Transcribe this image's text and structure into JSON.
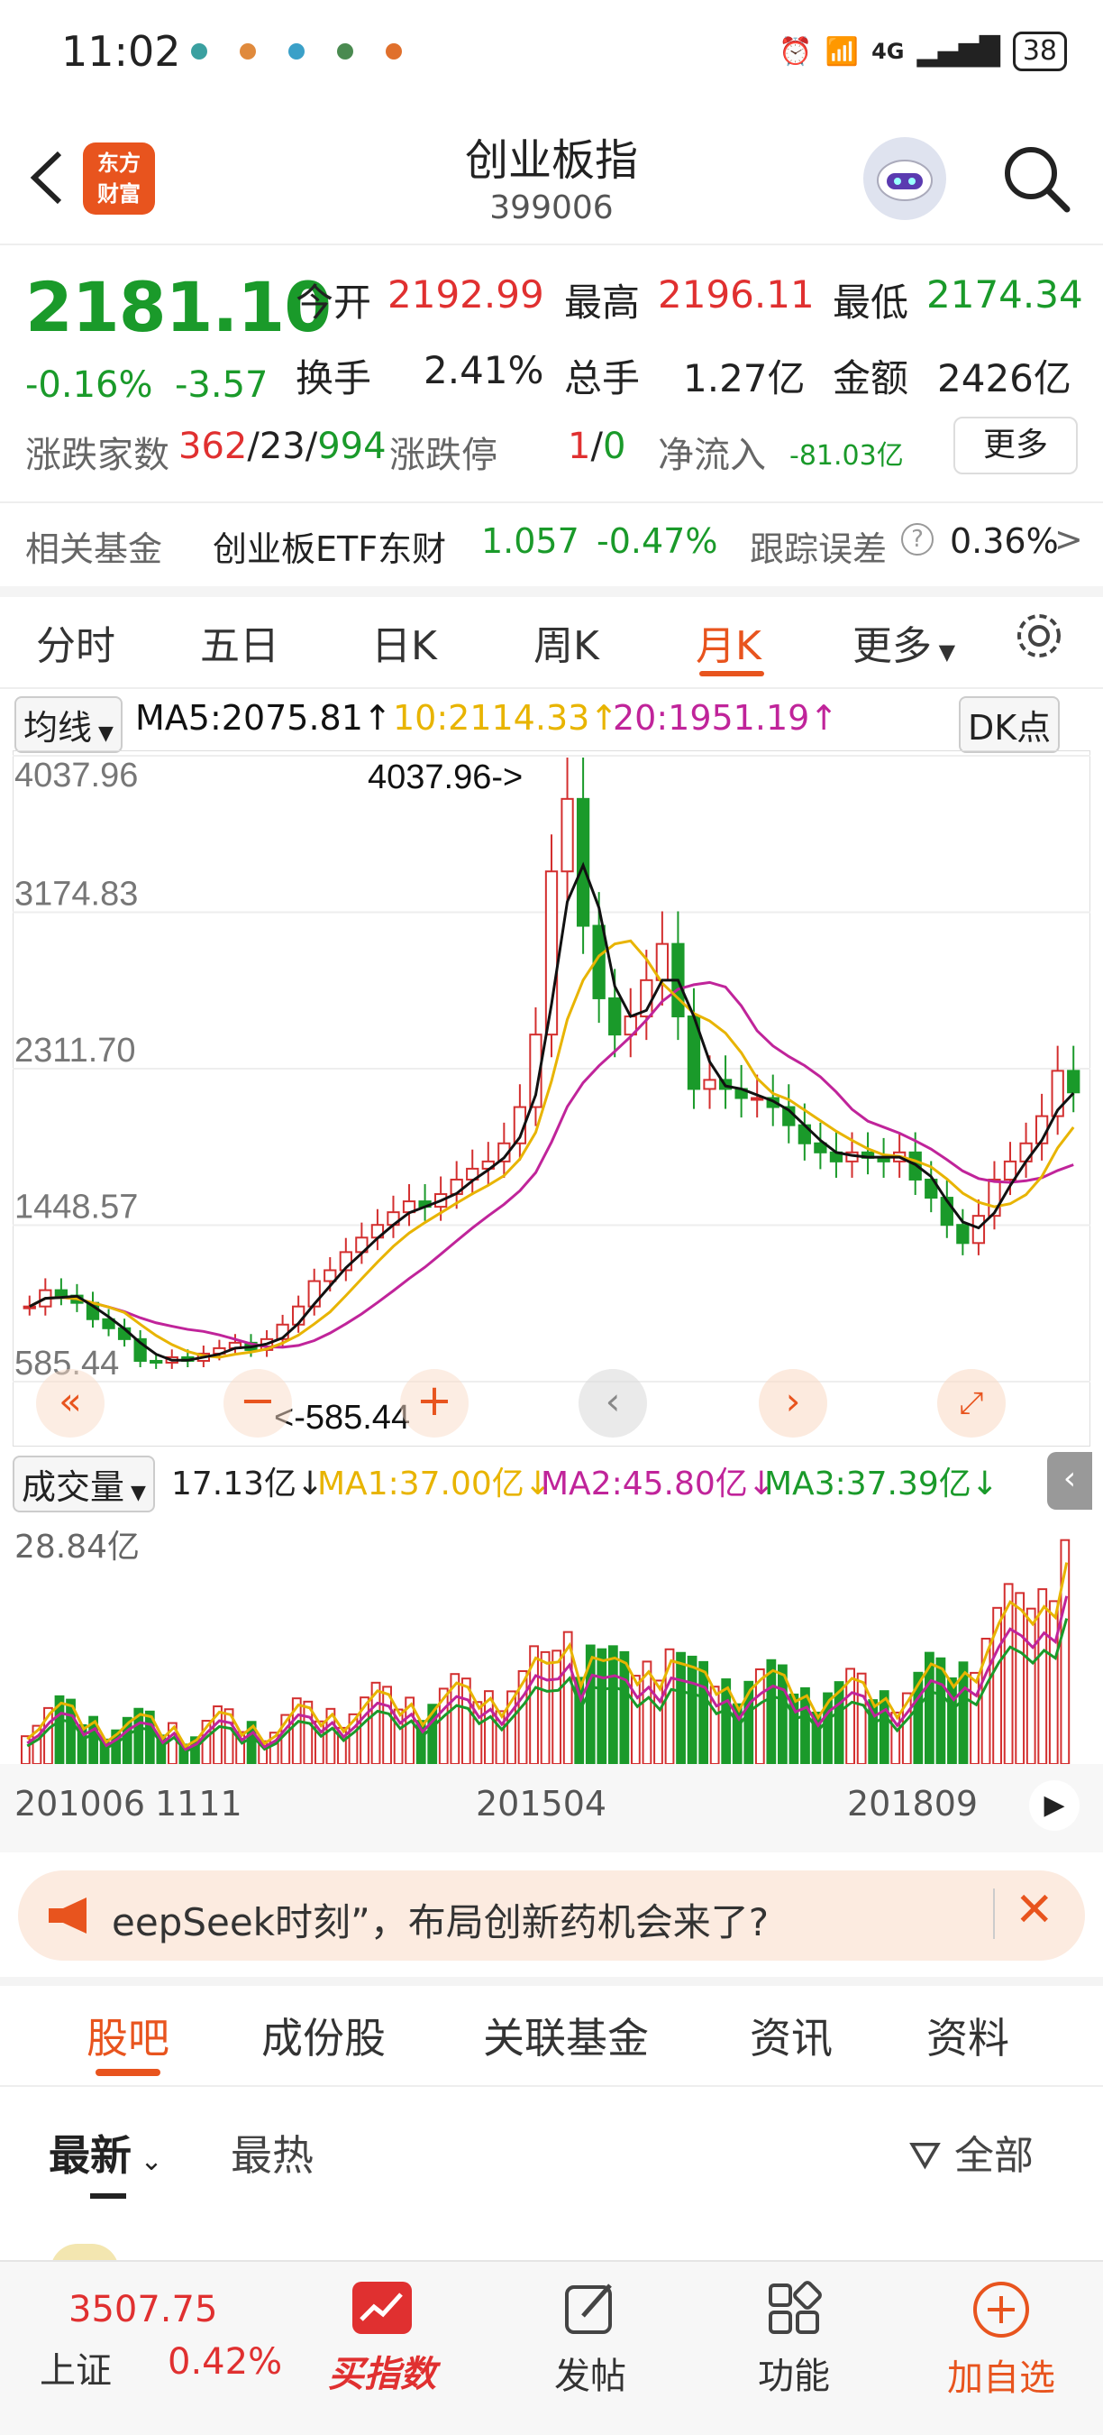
{
  "status": {
    "time": "11:02",
    "battery": "38",
    "net": "4G"
  },
  "header": {
    "logo": "东方\n财富",
    "title": "创业板指",
    "code": "399006"
  },
  "quote": {
    "price": "2181.10",
    "pct": "-0.16%",
    "chg": "-3.57",
    "open_label": "今开",
    "open": "2192.99",
    "high_label": "最高",
    "high": "2196.11",
    "low_label": "最低",
    "low": "2174.34",
    "turn_label": "换手",
    "turn": "2.41%",
    "vol_label": "总手",
    "vol": "1.27亿",
    "amt_label": "金额",
    "amt": "2426亿",
    "breadth_label": "涨跌家数",
    "up": "362",
    "flat": "23",
    "down": "994",
    "limit_label": "涨跌停",
    "limit_up": "1",
    "limit_down": "0",
    "flow_label": "净流入",
    "flow": "-81.03亿",
    "more": "更多"
  },
  "fund": {
    "label": "相关基金",
    "name": "创业板ETF东财",
    "price": "1.057",
    "pct": "-0.47%",
    "err_label": "跟踪误差",
    "err": "0.36%"
  },
  "tabs": [
    "分时",
    "五日",
    "日K",
    "周K",
    "月K",
    "更多"
  ],
  "indicator": {
    "sel": "均线",
    "ma5": "MA5:2075.81↑",
    "ma10": "10:2114.33↑",
    "ma20": "20:1951.19↑",
    "dk": "DK点"
  },
  "chart_data": {
    "type": "candlestick",
    "y_ticks": [
      "4037.96",
      "3174.83",
      "2311.70",
      "1448.57",
      "585.44"
    ],
    "ylim": [
      585.44,
      4037.96
    ],
    "max_label": "4037.96->",
    "min_label": "<-585.44",
    "x_labels": [
      "201006",
      "1111",
      "201504",
      "201809"
    ],
    "ma": [
      {
        "name": "MA5",
        "value": 2075.81,
        "color": "#111111"
      },
      {
        "name": "MA10",
        "value": 2114.33,
        "color": "#e8b400"
      },
      {
        "name": "MA20",
        "value": 1951.19,
        "color": "#c0249a"
      }
    ],
    "closes": [
      1000,
      1090,
      1060,
      1020,
      930,
      880,
      820,
      700,
      690,
      720,
      700,
      740,
      770,
      800,
      760,
      820,
      900,
      1000,
      1140,
      1200,
      1300,
      1380,
      1450,
      1520,
      1580,
      1550,
      1620,
      1700,
      1760,
      1800,
      1900,
      2100,
      2500,
      3400,
      3800,
      3100,
      2700,
      2500,
      2600,
      2800,
      3000,
      2600,
      2200,
      2250,
      2200,
      2150,
      2150,
      2100,
      2000,
      1900,
      1850,
      1800,
      1850,
      1820,
      1800,
      1850,
      1700,
      1600,
      1450,
      1350,
      1500,
      1700,
      1800,
      1900,
      2050,
      2300,
      2181
    ],
    "volume": {
      "label": "成交量",
      "cur": "17.13亿↓",
      "ma1": "MA1:37.00亿↓",
      "ma2": "MA2:45.80亿↓",
      "ma3": "MA3:37.39亿↓",
      "max": "28.84亿"
    }
  },
  "banner": {
    "text": "eepSeek时刻”，布局创新药机会来了?"
  },
  "btabs": [
    "股吧",
    "成份股",
    "关联基金",
    "资讯",
    "资料"
  ],
  "sort": {
    "latest": "最新",
    "hot": "最热",
    "filter": "全部"
  },
  "nav": {
    "index_price": "3507.75",
    "index_name": "上证",
    "index_pct": "0.42%",
    "buy": "买指数",
    "post": "发帖",
    "func": "功能",
    "add": "加自选"
  }
}
